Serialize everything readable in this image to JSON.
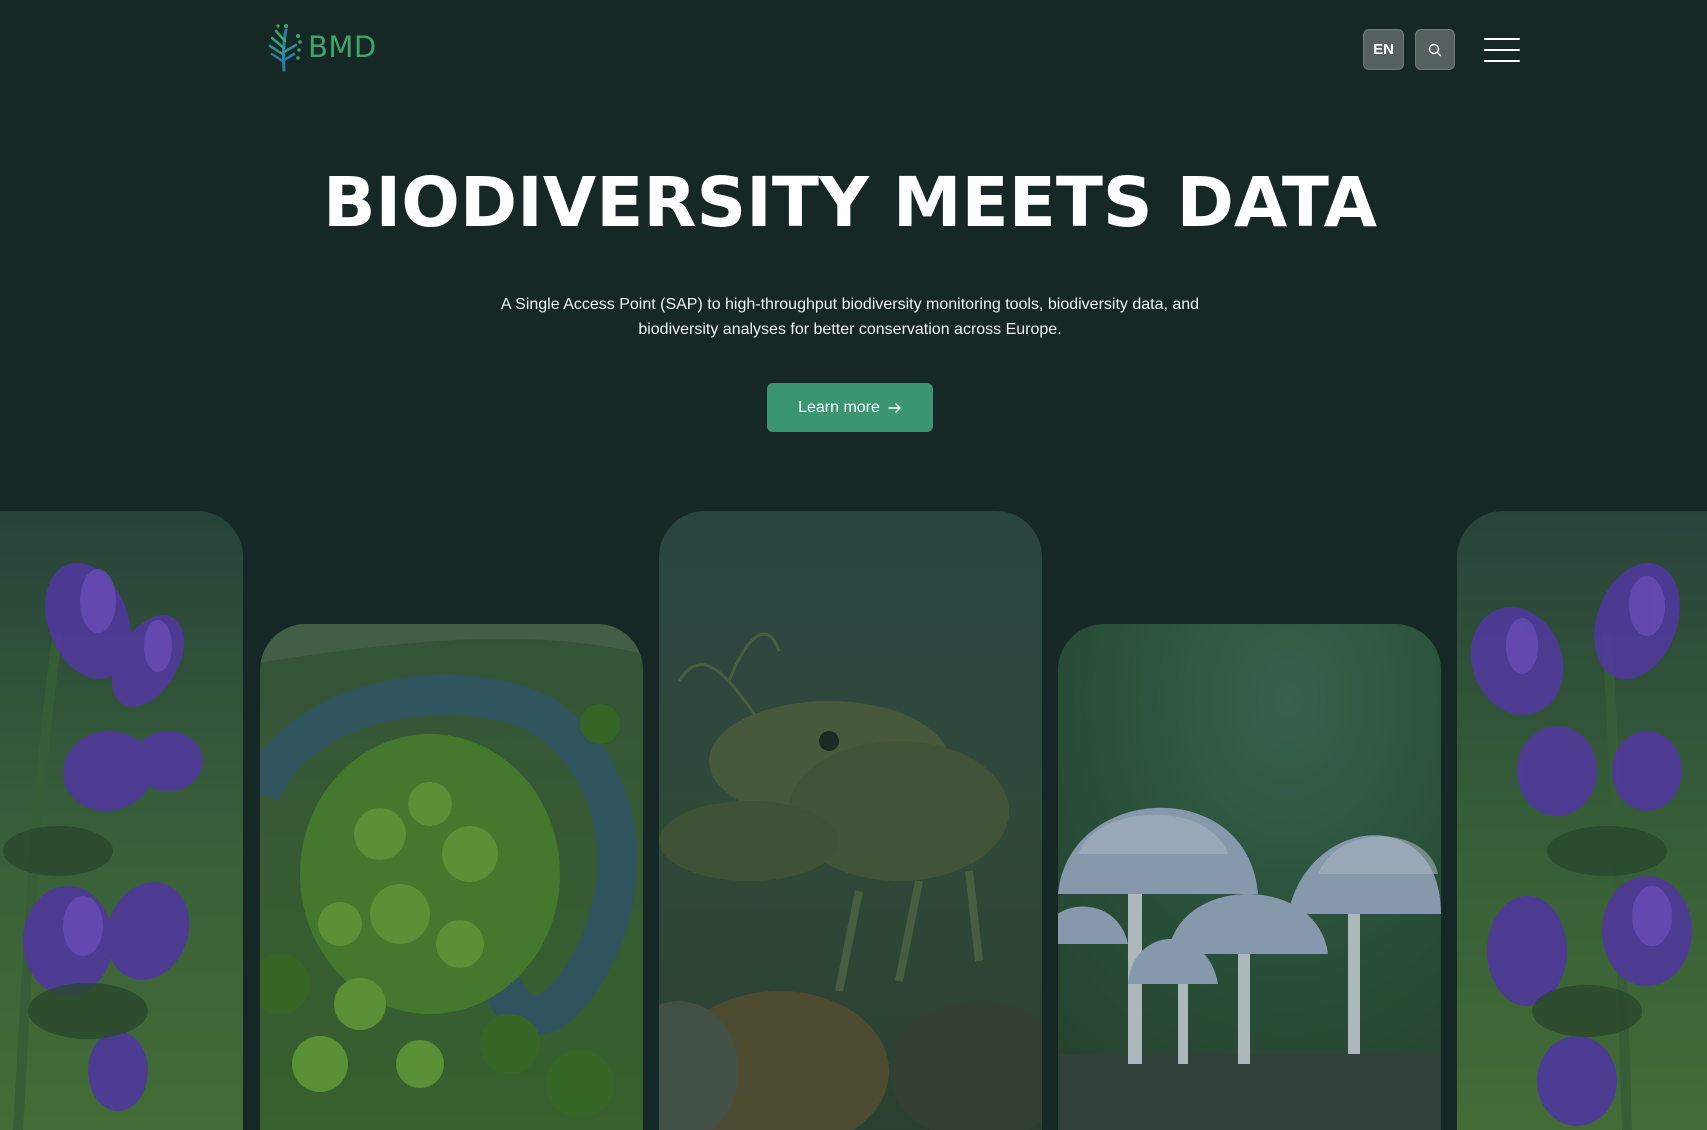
{
  "header": {
    "logo_text": "BMD",
    "language": "EN",
    "search_icon": "search-icon",
    "menu_icon": "hamburger-menu-icon"
  },
  "hero": {
    "title": "BIODIVERSITY MEETS DATA",
    "description": "A Single Access Point (SAP) to high-throughput biodiversity monitoring tools, biodiversity data, and biodiversity analyses for better conservation across Europe.",
    "cta_label": "Learn more",
    "cta_icon": "arrow-right-icon"
  },
  "gallery": {
    "images": [
      "purple-flowers-image",
      "river-aerial-image",
      "crayfish-image",
      "mushrooms-image",
      "purple-flowers-image"
    ]
  },
  "colors": {
    "background": "#162826",
    "accent": "#3a9670",
    "logo": "#3fa36a"
  }
}
